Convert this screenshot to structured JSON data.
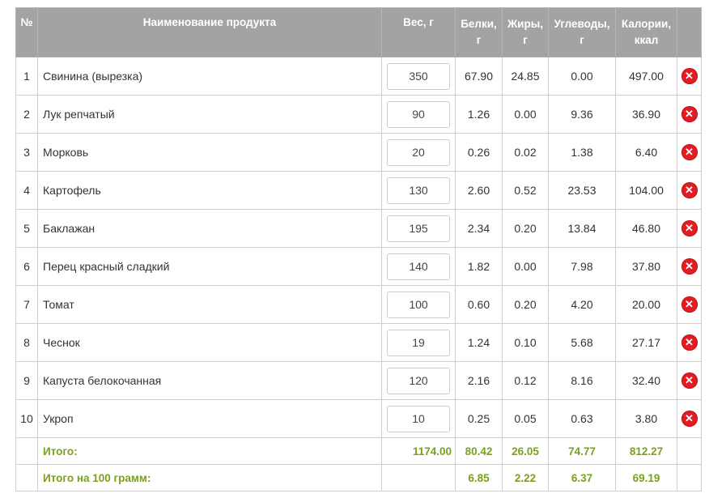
{
  "header": {
    "num": "№",
    "name": "Наименование продукта",
    "weight": "Вес, г",
    "protein_line1": "Белки,",
    "protein_line2": "г",
    "fat_line1": "Жиры,",
    "fat_line2": "г",
    "carbs_line1": "Углеводы,",
    "carbs_line2": "г",
    "cal_line1": "Калории,",
    "cal_line2": "ккал"
  },
  "rows": [
    {
      "num": "1",
      "name": "Свинина (вырезка)",
      "weight": "350",
      "protein": "67.90",
      "fat": "24.85",
      "carbs": "0.00",
      "cal": "497.00"
    },
    {
      "num": "2",
      "name": "Лук репчатый",
      "weight": "90",
      "protein": "1.26",
      "fat": "0.00",
      "carbs": "9.36",
      "cal": "36.90"
    },
    {
      "num": "3",
      "name": "Морковь",
      "weight": "20",
      "protein": "0.26",
      "fat": "0.02",
      "carbs": "1.38",
      "cal": "6.40"
    },
    {
      "num": "4",
      "name": "Картофель",
      "weight": "130",
      "protein": "2.60",
      "fat": "0.52",
      "carbs": "23.53",
      "cal": "104.00"
    },
    {
      "num": "5",
      "name": "Баклажан",
      "weight": "195",
      "protein": "2.34",
      "fat": "0.20",
      "carbs": "13.84",
      "cal": "46.80"
    },
    {
      "num": "6",
      "name": "Перец красный сладкий",
      "weight": "140",
      "protein": "1.82",
      "fat": "0.00",
      "carbs": "7.98",
      "cal": "37.80"
    },
    {
      "num": "7",
      "name": "Томат",
      "weight": "100",
      "protein": "0.60",
      "fat": "0.20",
      "carbs": "4.20",
      "cal": "20.00"
    },
    {
      "num": "8",
      "name": "Чеснок",
      "weight": "19",
      "protein": "1.24",
      "fat": "0.10",
      "carbs": "5.68",
      "cal": "27.17"
    },
    {
      "num": "9",
      "name": "Капуста белокочанная",
      "weight": "120",
      "protein": "2.16",
      "fat": "0.12",
      "carbs": "8.16",
      "cal": "32.40"
    },
    {
      "num": "10",
      "name": "Укроп",
      "weight": "10",
      "protein": "0.25",
      "fat": "0.05",
      "carbs": "0.63",
      "cal": "3.80"
    }
  ],
  "totals": {
    "label": "Итого:",
    "weight": "1174.00",
    "protein": "80.42",
    "fat": "26.05",
    "carbs": "74.77",
    "cal": "812.27"
  },
  "per100": {
    "label": "Итого на 100 грамм:",
    "protein": "6.85",
    "fat": "2.22",
    "carbs": "6.37",
    "cal": "69.19"
  },
  "icons": {
    "delete": "close-circle-icon",
    "delete_color": "#e31b23"
  },
  "colors": {
    "header_bg": "#a3a3a3",
    "total_text": "#7aa01d"
  }
}
